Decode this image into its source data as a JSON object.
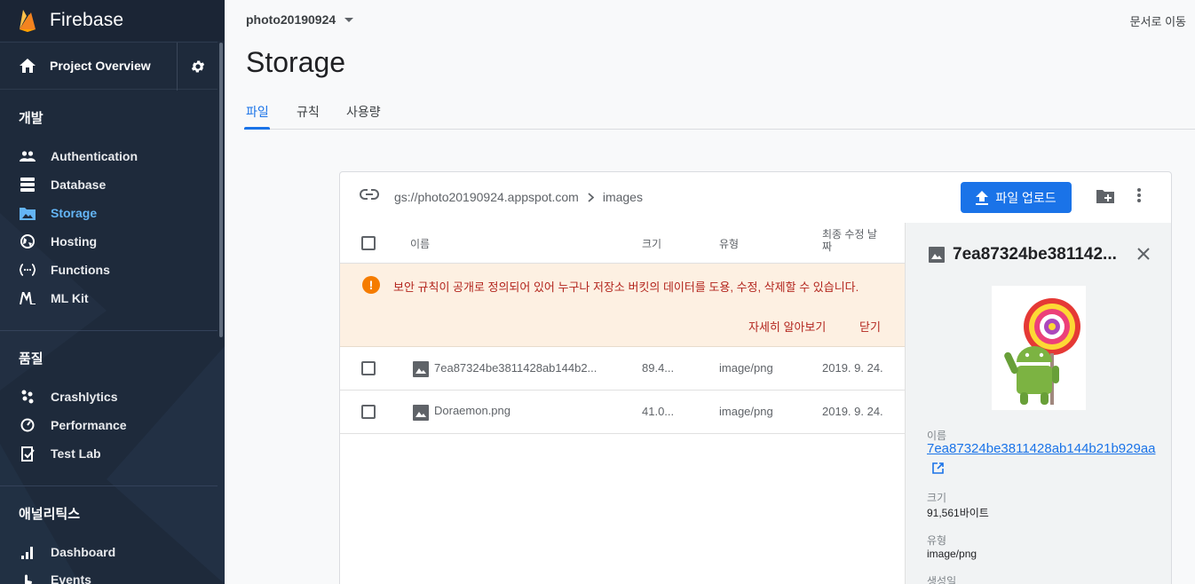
{
  "app": {
    "brand": "Firebase",
    "project_overview": "Project Overview"
  },
  "sidebar": {
    "sections": [
      {
        "title": "개발",
        "items": [
          "Authentication",
          "Database",
          "Storage",
          "Hosting",
          "Functions",
          "ML Kit"
        ]
      },
      {
        "title": "품질",
        "items": [
          "Crashlytics",
          "Performance",
          "Test Lab"
        ]
      },
      {
        "title": "애널리틱스",
        "items": [
          "Dashboard",
          "Events"
        ]
      }
    ],
    "active_item": "Storage"
  },
  "topbar": {
    "project": "photo20190924",
    "docs_link": "문서로 이동"
  },
  "page": {
    "title": "Storage"
  },
  "tabs": [
    {
      "label": "파일"
    },
    {
      "label": "규칙"
    },
    {
      "label": "사용량"
    }
  ],
  "storage": {
    "bucket": "gs://photo20190924.appspot.com",
    "folder": "images",
    "upload_label": "파일 업로드",
    "columns": {
      "name": "이름",
      "size": "크기",
      "type": "유형",
      "modified": "최종 수정 날짜"
    },
    "warning": {
      "text": "보안 규칙이 공개로 정의되어 있어 누구나 저장소 버킷의 데이터를 도용, 수정, 삭제할 수 있습니다.",
      "learn_more": "자세히 알아보기",
      "close": "닫기"
    },
    "files": [
      {
        "name": "7ea87324be3811428ab144b2...",
        "size": "89.4...",
        "type": "image/png",
        "modified": "2019. 9. 24."
      },
      {
        "name": "Doraemon.png",
        "size": "41.0...",
        "type": "image/png",
        "modified": "2019. 9. 24."
      }
    ]
  },
  "detail": {
    "title": "7ea87324be381142...",
    "name_label": "이름",
    "name_value": "7ea87324be3811428ab144b21b929aa",
    "size_label": "크기",
    "size_value": "91,561바이트",
    "type_label": "유형",
    "type_value": "image/png",
    "created_label": "생성일"
  },
  "colors": {
    "accent": "#1a73e8",
    "sidebar_bg": "#1e2a3b",
    "warning_text": "#b3261e",
    "warning_bg": "#fdf0e2"
  }
}
